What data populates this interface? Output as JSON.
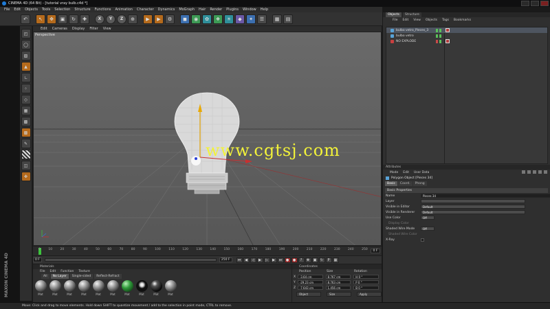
{
  "window": {
    "title": "CINEMA 4D (64 Bit) - [tutorial vray bulb.c4d *]"
  },
  "menu": [
    "File",
    "Edit",
    "Objects",
    "Tools",
    "Selection",
    "Structure",
    "Functions",
    "Animation",
    "Character",
    "Dynamics",
    "MoGraph",
    "Hair",
    "Render",
    "Plugins",
    "Window",
    "Help"
  ],
  "toolbar": {
    "axis_buttons": [
      "X",
      "Y",
      "Z"
    ]
  },
  "viewport": {
    "menu": [
      "Edit",
      "Cameras",
      "Display",
      "Filter",
      "View"
    ],
    "label": "Perspective",
    "watermark": "www.cgtsj.com"
  },
  "timeline": {
    "ticks": [
      "0",
      "10",
      "20",
      "30",
      "40",
      "50",
      "60",
      "70",
      "80",
      "90",
      "100",
      "110",
      "120",
      "130",
      "140",
      "150",
      "160",
      "170",
      "180",
      "190",
      "200",
      "210",
      "220",
      "230",
      "240",
      "250"
    ],
    "current_frame": "0 F",
    "start_field": "0 F",
    "end_field": "250 F"
  },
  "materials": {
    "title": "Materials",
    "menu": [
      "File",
      "Edit",
      "Function",
      "Texture"
    ],
    "layer_tabs": [
      "All",
      "No Layer",
      "Single-sided",
      "Reflect-Refract"
    ],
    "swatches": [
      {
        "label": "Mat",
        "kind": "grey"
      },
      {
        "label": "Mat",
        "kind": "grey"
      },
      {
        "label": "Mat",
        "kind": "grey"
      },
      {
        "label": "Mat",
        "kind": "grey"
      },
      {
        "label": "Mat",
        "kind": "grey"
      },
      {
        "label": "Mat",
        "kind": "grey"
      },
      {
        "label": "Mat",
        "kind": "green"
      },
      {
        "label": "Mat",
        "kind": "blackw"
      },
      {
        "label": "Mat",
        "kind": "dark"
      },
      {
        "label": "Mat",
        "kind": "grey"
      }
    ]
  },
  "coordinates": {
    "title": "Coordinates",
    "headers": [
      "Position",
      "Size",
      "Rotation"
    ],
    "rows": [
      {
        "axis": "X",
        "position": "-3.64 cm",
        "size": "8.767 cm",
        "rotation": "H 0 °"
      },
      {
        "axis": "Y",
        "position": "-29.23 cm",
        "size": "8.763 cm",
        "rotation": "P 0 °"
      },
      {
        "axis": "Z",
        "position": "-7.643 cm",
        "size": "1.456 cm",
        "rotation": "B 0 °"
      }
    ],
    "mode_select": "Object",
    "size_select": "Size",
    "apply_label": "Apply"
  },
  "objects_panel": {
    "tabs": [
      "Objects",
      "Structure"
    ],
    "menu": [
      "File",
      "Edit",
      "View",
      "Objects",
      "Tags",
      "Bookmarks"
    ],
    "items": [
      {
        "name": "bulbo vetro_Pieces_3",
        "selected": true
      },
      {
        "name": "bulbo vetro",
        "selected": false
      },
      {
        "name": "NO EXPLODE",
        "selected": false
      }
    ]
  },
  "attributes": {
    "title": "Attributes",
    "menu": [
      "Mode",
      "Edit",
      "User Data"
    ],
    "object_name": "Polygon Object [Pieces 34]",
    "tabs": [
      "Basic",
      "Coord.",
      "Phong"
    ],
    "section": "Basic Properties",
    "props": [
      {
        "label": "Name",
        "value": "Pieces 34",
        "style": "dark"
      },
      {
        "label": "Layer",
        "value": "",
        "style": "normal"
      },
      {
        "label": "Visible in Editor",
        "value": "Default",
        "style": "normal"
      },
      {
        "label": "Visible in Renderer",
        "value": "Default",
        "style": "normal"
      },
      {
        "label": "Use Color",
        "value": "Off",
        "style": "short"
      },
      {
        "label": "Display Color",
        "value": "",
        "style": "dim"
      },
      {
        "label": "Shaded Wire Mode",
        "value": "Off",
        "style": "short"
      },
      {
        "label": "Shaded Wire Color",
        "value": "",
        "style": "dim"
      },
      {
        "label": "X-Ray",
        "value": "",
        "style": "check"
      }
    ]
  },
  "statusbar": {
    "text": "Move: Click and drag to move elements. Hold down SHIFT to quantize movement / add to the selection in point mode, CTRL to remove."
  },
  "branding": {
    "vendor": "MAXON",
    "product": "CINEMA 4D"
  }
}
